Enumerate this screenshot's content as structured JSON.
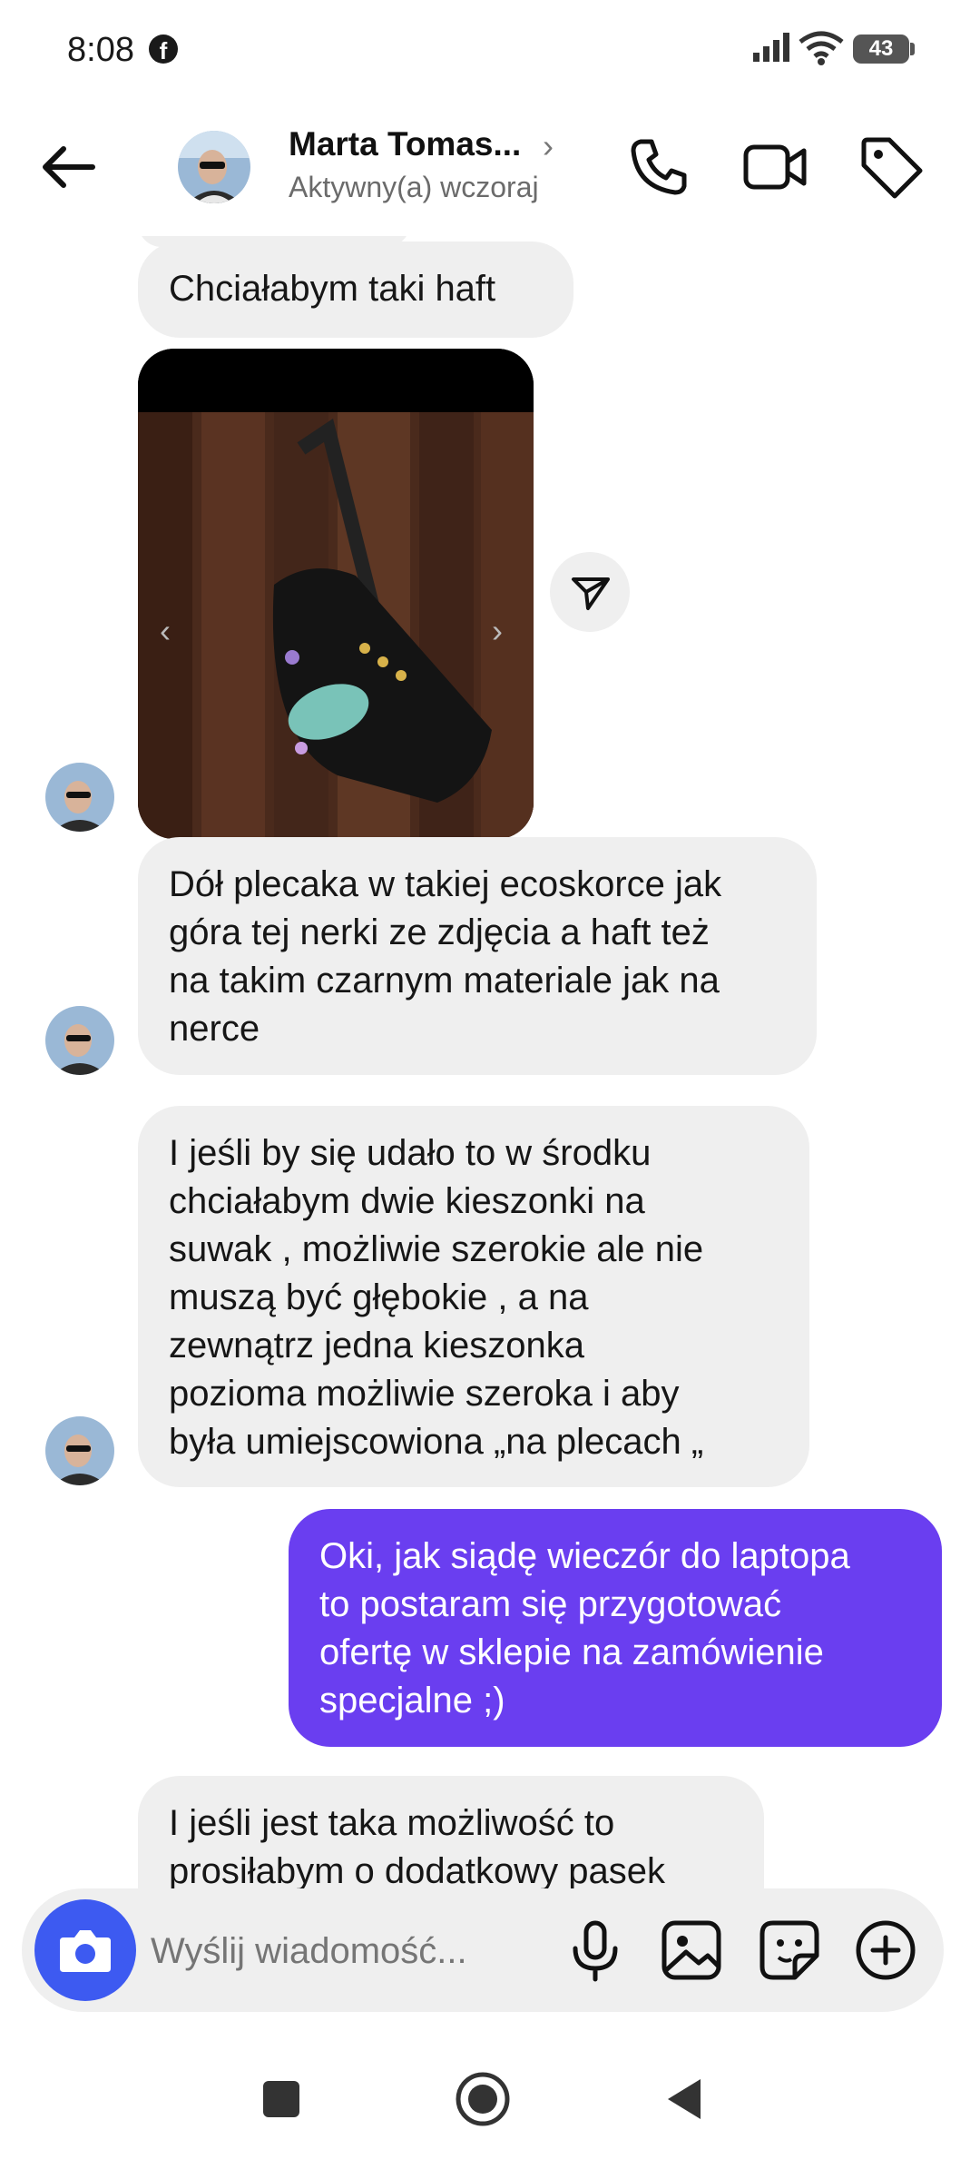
{
  "status_bar": {
    "time": "8:08",
    "battery": "43"
  },
  "header": {
    "contact_name": "Marta Tomas...",
    "contact_status": "Aktywny(a) wczoraj"
  },
  "messages": [
    {
      "direction": "incoming",
      "text": "Chciałabym taki haft"
    },
    {
      "direction": "incoming",
      "type": "image"
    },
    {
      "direction": "incoming",
      "text": "Dół plecaka w takiej ecoskorce jak góra tej nerki ze zdjęcia a haft też na takim czarnym materiale jak na nerce",
      "lines": [
        "Dół plecaka w takiej ecoskorce jak",
        "góra tej nerki ze zdjęcia a haft też",
        "na takim czarnym materiale jak na",
        "nerce"
      ]
    },
    {
      "direction": "incoming",
      "text": "I jeśli by się udało to w środku chciałabym dwie kieszonki na suwak , możliwie szerokie ale nie muszą być głębokie , a na zewnątrz jedna kieszonka pozioma możliwie szeroka i aby była umiejscowiona „na plecach „",
      "lines": [
        "I jeśli by się udało to w środku",
        "chciałabym dwie kieszonki na",
        "suwak , możliwie szerokie ale nie",
        "muszą być głębokie , a na",
        "zewnątrz jedna kieszonka",
        "pozioma możliwie szeroka i aby",
        "była umiejscowiona „na plecach „"
      ]
    },
    {
      "direction": "outgoing",
      "text": "Oki, jak siądę wieczór do laptopa to postaram się przygotować ofertę w sklepie na zamówienie specjalne ;)",
      "lines": [
        "Oki, jak siądę wieczór do laptopa",
        "to postaram się przygotować",
        "ofertę w sklepie na zamówienie",
        "specjalne ;)"
      ]
    },
    {
      "direction": "incoming",
      "text": "I jeśli jest taka możliwość to prosiłabym o dodatkowy pasek",
      "lines": [
        "I jeśli jest taka możliwość to",
        "prosiłabym o dodatkowy pasek"
      ]
    }
  ],
  "composer": {
    "placeholder": "Wyślij wiadomość..."
  },
  "colors": {
    "outgoing_bubble": "#6a3ef0",
    "incoming_bubble": "#efefef",
    "camera_button": "#3d5af1"
  },
  "icons": [
    "back-arrow-icon",
    "phone-icon",
    "video-camera-icon",
    "tag-icon",
    "share-icon",
    "camera-icon",
    "microphone-icon",
    "gallery-icon",
    "sticker-icon",
    "plus-icon"
  ]
}
